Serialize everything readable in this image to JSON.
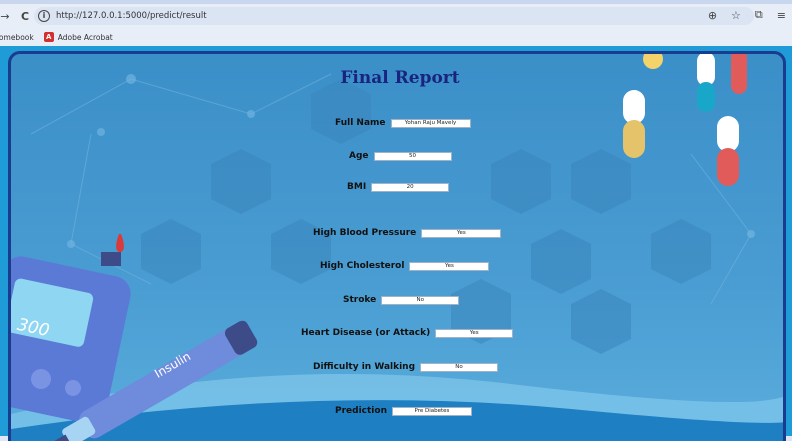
{
  "browser": {
    "url": "http://127.0.0.1:5000/predict/result",
    "bookmarks": [
      "romebook",
      "Adobe Acrobat"
    ],
    "acrobat_glyph": "A"
  },
  "report": {
    "title": "Final Report",
    "fields": [
      {
        "label": "Full Name",
        "value": "Yohan Raju Mavely"
      },
      {
        "label": "Age",
        "value": "50"
      },
      {
        "label": "BMI",
        "value": "20"
      },
      {
        "label": "High Blood Pressure",
        "value": "Yes"
      },
      {
        "label": "High Cholesterol",
        "value": "Yes"
      },
      {
        "label": "Stroke",
        "value": "No"
      },
      {
        "label": "Heart Disease (or Attack)",
        "value": "Yes"
      },
      {
        "label": "Difficulty in Walking",
        "value": "No"
      },
      {
        "label": "Prediction",
        "value": "Pre Diabetes"
      }
    ]
  },
  "illustration": {
    "meter_reading": "300",
    "pen_label": "Insulin"
  }
}
